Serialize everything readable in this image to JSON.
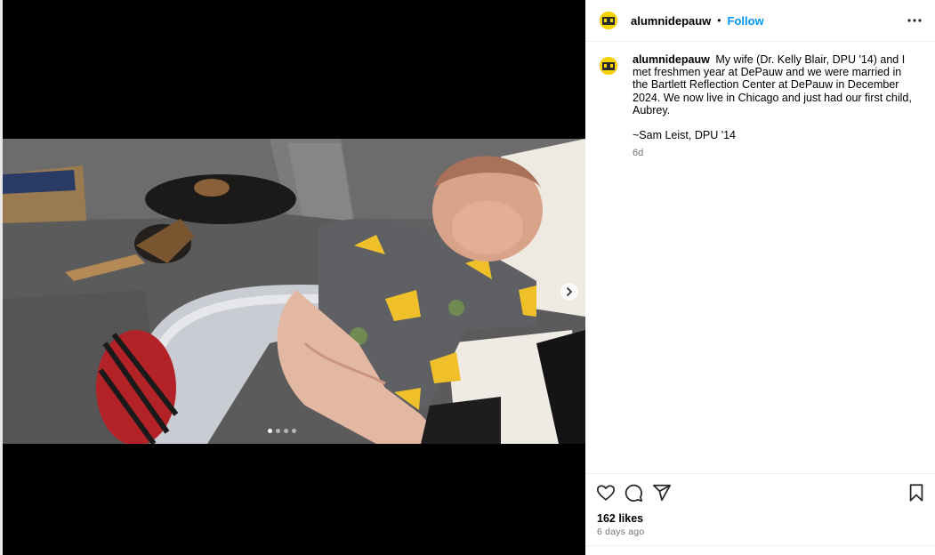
{
  "post": {
    "username": "alumnidepauw",
    "separator": "•",
    "follow_label": "Follow",
    "caption_text": "My wife (Dr. Kelly Blair, DPU '14) and I met freshmen year at DePauw and we were married in the Bartlett Reflection Center at DePauw in December 2024. We now live in Chicago and just had our first child, Aubrey.",
    "signature": "~Sam Leist, DPU '14",
    "caption_age": "6d",
    "likes": "162 likes",
    "posted_ago": "6 days ago"
  },
  "carousel": {
    "slide_count": 4,
    "active_index": 0
  },
  "icons": {
    "more": "more-options-icon",
    "like": "heart-icon",
    "comment": "comment-icon",
    "share": "share-icon",
    "save": "bookmark-icon",
    "next": "chevron-right-icon"
  },
  "colors": {
    "accent": "#0095f6",
    "muted": "#737373"
  }
}
